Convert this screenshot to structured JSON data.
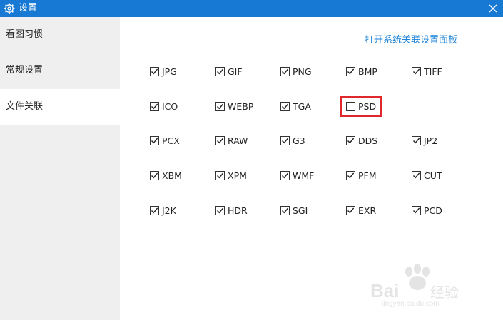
{
  "window": {
    "title": "设置"
  },
  "sidebar": {
    "items": [
      {
        "label": "看图习惯",
        "active": false
      },
      {
        "label": "常规设置",
        "active": false
      },
      {
        "label": "文件关联",
        "active": true
      }
    ]
  },
  "main": {
    "open_panel_link": "打开系统关联设置面板",
    "formats": [
      {
        "label": "JPG",
        "checked": true
      },
      {
        "label": "GIF",
        "checked": true
      },
      {
        "label": "PNG",
        "checked": true
      },
      {
        "label": "BMP",
        "checked": true
      },
      {
        "label": "TIFF",
        "checked": true
      },
      {
        "label": "ICO",
        "checked": true
      },
      {
        "label": "WEBP",
        "checked": true
      },
      {
        "label": "TGA",
        "checked": true
      },
      {
        "label": "PSD",
        "checked": false
      },
      {
        "label": "PCX",
        "checked": true
      },
      {
        "label": "RAW",
        "checked": true
      },
      {
        "label": "G3",
        "checked": true
      },
      {
        "label": "DDS",
        "checked": true
      },
      {
        "label": "JP2",
        "checked": true
      },
      {
        "label": "XBM",
        "checked": true
      },
      {
        "label": "XPM",
        "checked": true
      },
      {
        "label": "WMF",
        "checked": true
      },
      {
        "label": "PFM",
        "checked": true
      },
      {
        "label": "CUT",
        "checked": true
      },
      {
        "label": "J2K",
        "checked": true
      },
      {
        "label": "HDR",
        "checked": true
      },
      {
        "label": "SGI",
        "checked": true
      },
      {
        "label": "EXR",
        "checked": true
      },
      {
        "label": "PCD",
        "checked": true
      }
    ]
  },
  "colors": {
    "titlebar": "#1879d5",
    "link": "#1a82d8",
    "highlight": "#e0282c"
  },
  "watermark": {
    "brand": "Baidu经验",
    "url": "jingyan.baidu.com"
  }
}
